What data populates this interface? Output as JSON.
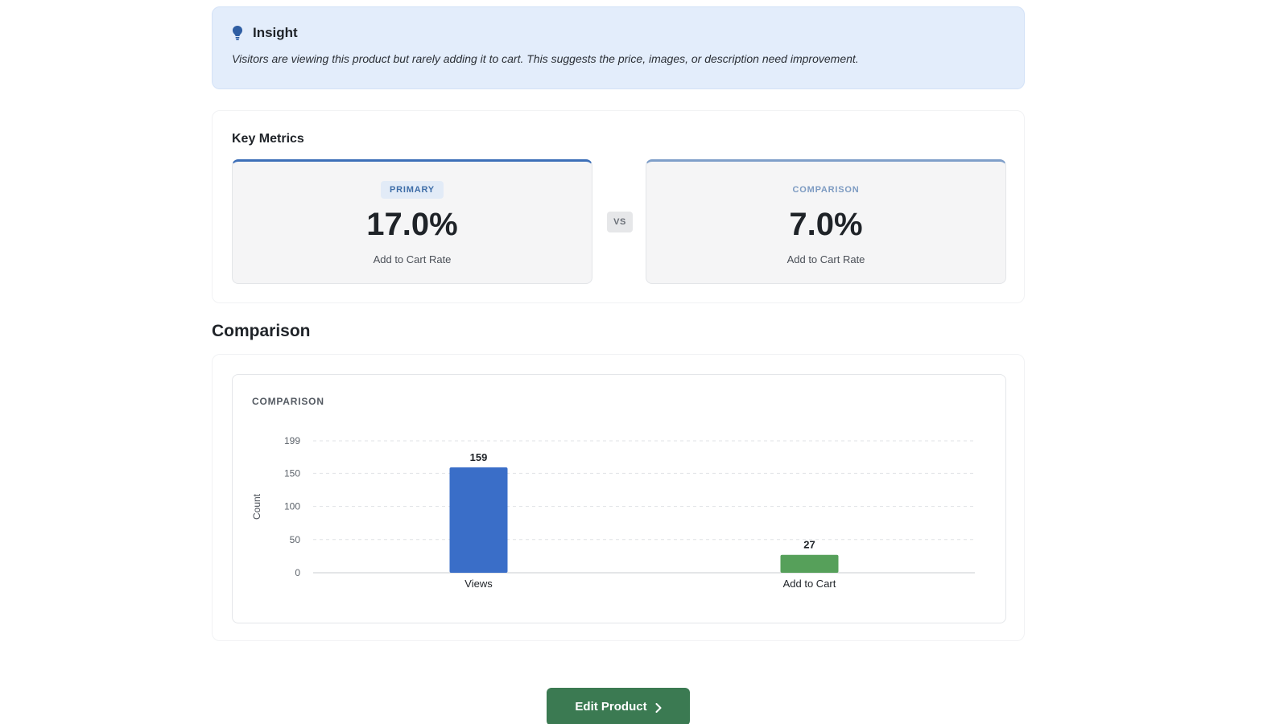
{
  "insight": {
    "title": "Insight",
    "text": "Visitors are viewing this product but rarely adding it to cart. This suggests the price, images, or description need improvement.",
    "icon": "lightbulb-icon",
    "icon_color": "#2f5ea3"
  },
  "metrics": {
    "title": "Key Metrics",
    "primary": {
      "badge": "PRIMARY",
      "value": "17.0%",
      "label": "Add to Cart Rate"
    },
    "vs_label": "VS",
    "comparison": {
      "badge": "COMPARISON",
      "value": "7.0%",
      "label": "Add to Cart Rate"
    }
  },
  "comparison_section": {
    "heading": "Comparison",
    "chart_title": "COMPARISON"
  },
  "chart_data": {
    "type": "bar",
    "title": "COMPARISON",
    "categories": [
      "Views",
      "Add to Cart"
    ],
    "values": [
      159,
      27
    ],
    "colors": [
      "#3a6ec8",
      "#56a05a"
    ],
    "xlabel": "",
    "ylabel": "Count",
    "ylim": [
      0,
      199
    ],
    "yticks": [
      0,
      50,
      100,
      150,
      199
    ],
    "grid": true,
    "data_labels": true
  },
  "actions": {
    "edit_label": "Edit Product",
    "edit_icon": "chevron-right-icon",
    "edit_color": "#3b7a52"
  }
}
